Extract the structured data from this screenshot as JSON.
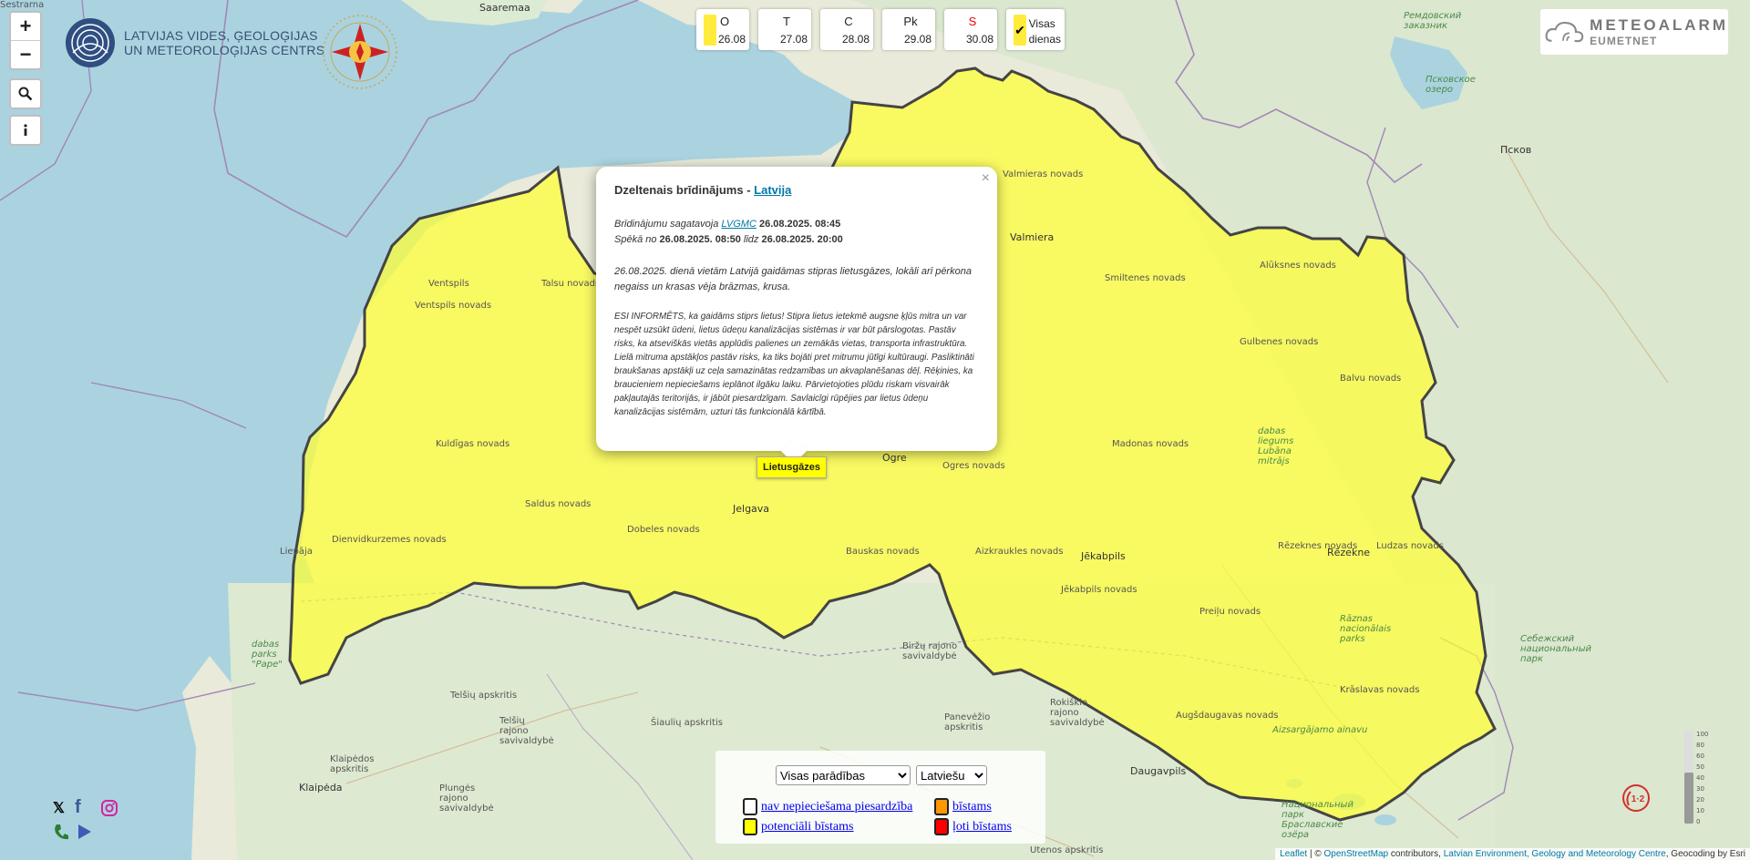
{
  "map_labels": {
    "saaremaa": "Saaremaa",
    "sestrarna": "Sestrarna",
    "ventspils": "Ventspils",
    "ventspils_novads": "Ventspils novads",
    "talsu_novads": "Talsu novads",
    "kuldigas_novads": "Kuldīgas novads",
    "liepaja": "Liepāja",
    "dienvidkurzemes_novads": "Dienvidkurzemes novads",
    "saldus_novads": "Saldus novads",
    "dobeles_novads": "Dobeles novads",
    "jelgava": "Jelgava",
    "bauskas_novads": "Bauskas novads",
    "ogre": "Ogre",
    "ogres_novads": "Ogres novads",
    "valmiera": "Valmiera",
    "valmieras_novads": "Valmieras novads",
    "smiltenes_novads": "Smiltenes novads",
    "aluksnes_novads": "Alūksnes novads",
    "gulbenes_novads": "Gulbenes novads",
    "balvu_novads": "Balvu novads",
    "madonas_novads": "Madonas novads",
    "lubana_mitraji": "dabas liegums Lubāna mitrājs",
    "rezekne": "Rēzekne",
    "rezeknes_novads": "Rēzeknes novads",
    "ludzas_novads": "Ludzas novads",
    "jekabpils": "Jēkabpils",
    "jekabpils_novads": "Jēkabpils novads",
    "aizkraukles_novads": "Aizkraukles novads",
    "preilu_novads": "Preiļu novads",
    "raznas_parks": "Rāznas nacionālais parks",
    "kraslavas_novads": "Krāslavas novads",
    "augsdaugavas_novads": "Augšdaugavas novads",
    "daugavpils": "Daugavpils",
    "aizsargajamo_ainavu": "Aizsargājamo ainavu",
    "pskov": "Псков",
    "pskov_lake": "Псковское озеро",
    "sebezh": "Себежский национальный парк",
    "braslav": "Национальный парк Браславские озёра",
    "remdovsky": "Ремдовский заказник",
    "telsiu": "Telšių apskritis",
    "telsiu_sav": "Telšių rajono savivaldybė",
    "siauliu": "Šiaulių apskritis",
    "panevezio": "Panevėžio apskritis",
    "birzu": "Biržų rajono savivaldybė",
    "rokiskio": "Rokiškio rajono savivaldybė",
    "utenos": "Utenos apskritis",
    "klaipedos": "Klaipėdos apskritis",
    "klaipeda": "Klaipėda",
    "plunges": "Plungės rajono savivaldybė",
    "pape": "dabas parks \"Pape\""
  },
  "controls": {
    "zoom_in": "+",
    "zoom_out": "−"
  },
  "lvgmc_logo": {
    "line1": "LATVIJAS VIDES, ĢEOLOĢIJAS",
    "line2": "UN METEOROLOĢIJAS CENTRS"
  },
  "days": [
    {
      "label": "O",
      "date": "26.08",
      "color": "#ffeb3b"
    },
    {
      "label": "T",
      "date": "27.08"
    },
    {
      "label": "C",
      "date": "28.08"
    },
    {
      "label": "Pk",
      "date": "29.08"
    },
    {
      "label": "S",
      "date": "30.08"
    }
  ],
  "all_days": {
    "line1": "Visas",
    "line2": "dienas",
    "checked": true
  },
  "meteoalarm": {
    "title": "METEOALARM",
    "subtitle": "EUMETNET"
  },
  "popup": {
    "title_prefix": "Dzeltenais brīdinājums - ",
    "title_link": "Latvija",
    "prepared_by_label": "Brīdinājumu sagatavoja ",
    "prepared_by_link": "LVGMC",
    "prepared_time": " 26.08.2025. 08:45",
    "valid_label": "Spēkā no ",
    "valid_from": "26.08.2025. 08:50",
    "valid_until_label": " līdz ",
    "valid_until": "26.08.2025. 20:00",
    "description": "26.08.2025. dienā vietām Latvijā gaidāmas stipras lietusgāzes, lokāli arī pērkona negaiss un krasas vēja brāzmas, krusa.",
    "advice": "ESI INFORMĒTS, ka gaidāms stiprs lietus! Stipra lietus ietekmē augsne ķļūs mitra un var nespēt uzsūkt ūdeni, lietus ūdeņu kanalizācijas sistēmas ir var būt pārslogotas. Pastāv risks, ka atseviškās vietās applūdis palienes un zemākās vietas, transporta infrastruktūra. Lielā mitruma apstākļos pastāv risks, ka tiks bojāti pret mitrumu jūtīgi kultūraugi. Pasliktināti braukšanas apstākļi uz ceļa samazinātas redzamības un akvaplanēšanas dēļ. Rēķinies, ka braucieniem nepieciešams ieplānot ilgāku laiku. Pārvietojoties plūdu riskam visvairāk pakļautajās teritorijās, ir jābūt piesardzīgam. Savlaicīgi rūpējies par lietus ūdeņu kanalizācijas sistēmām, uzturi tās funkcionālā kārtībā.",
    "close": "×"
  },
  "marker_label": "Lietusgāzes",
  "legend": {
    "filter_selected": "Visas parādības",
    "language_selected": "Latviešu",
    "items": [
      {
        "label": "nav nepieciešama piesardzība",
        "color": "#ffffff"
      },
      {
        "label": "bīstams",
        "color": "#ff9800"
      },
      {
        "label": "potenciāli bīstams",
        "color": "#ffff00"
      },
      {
        "label": "ļoti bīstams",
        "color": "#ff0000"
      }
    ]
  },
  "attribution": {
    "leaflet": "Leaflet",
    "sep1": " | © ",
    "osm": "OpenStreetMap",
    "contrib": " contributors, ",
    "lvgmc": "Latvian Environment, Geology and Meteorology Centre",
    "geocoding": ", Geocoding by Esri"
  },
  "scale_labels": [
    "100",
    "80",
    "60",
    "50",
    "40",
    "30",
    "20",
    "10",
    "0"
  ]
}
